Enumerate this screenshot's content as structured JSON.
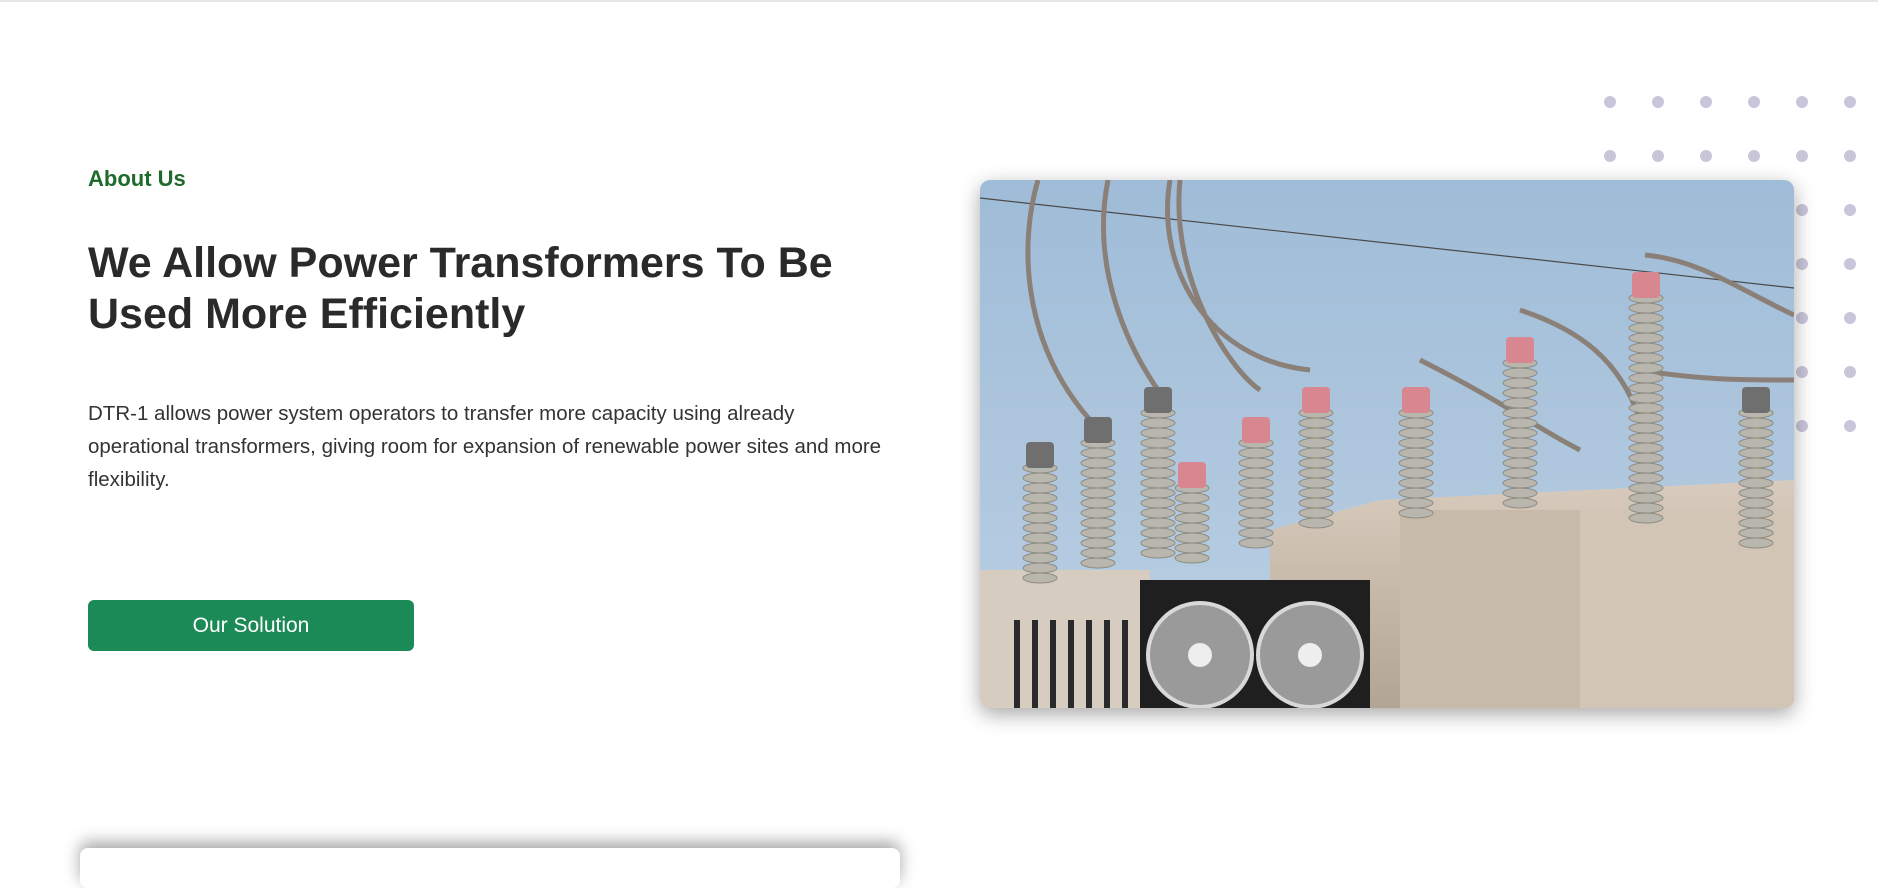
{
  "about": {
    "label": "About Us",
    "heading": "We Allow Power Transformers To Be Used More Efficiently",
    "description": "DTR-1 allows power system operators to transfer more capacity using already operational transformers, giving room for expansion of renewable power sites and more flexibility.",
    "button_label": "Our Solution"
  },
  "image": {
    "icon": "power-transformer-photo"
  },
  "colors": {
    "accent_green": "#1c8a57",
    "label_green": "#1e6b2c",
    "heading": "#2a2a2a",
    "body_text": "#333333",
    "dot_pattern": "#c9c6d9"
  }
}
